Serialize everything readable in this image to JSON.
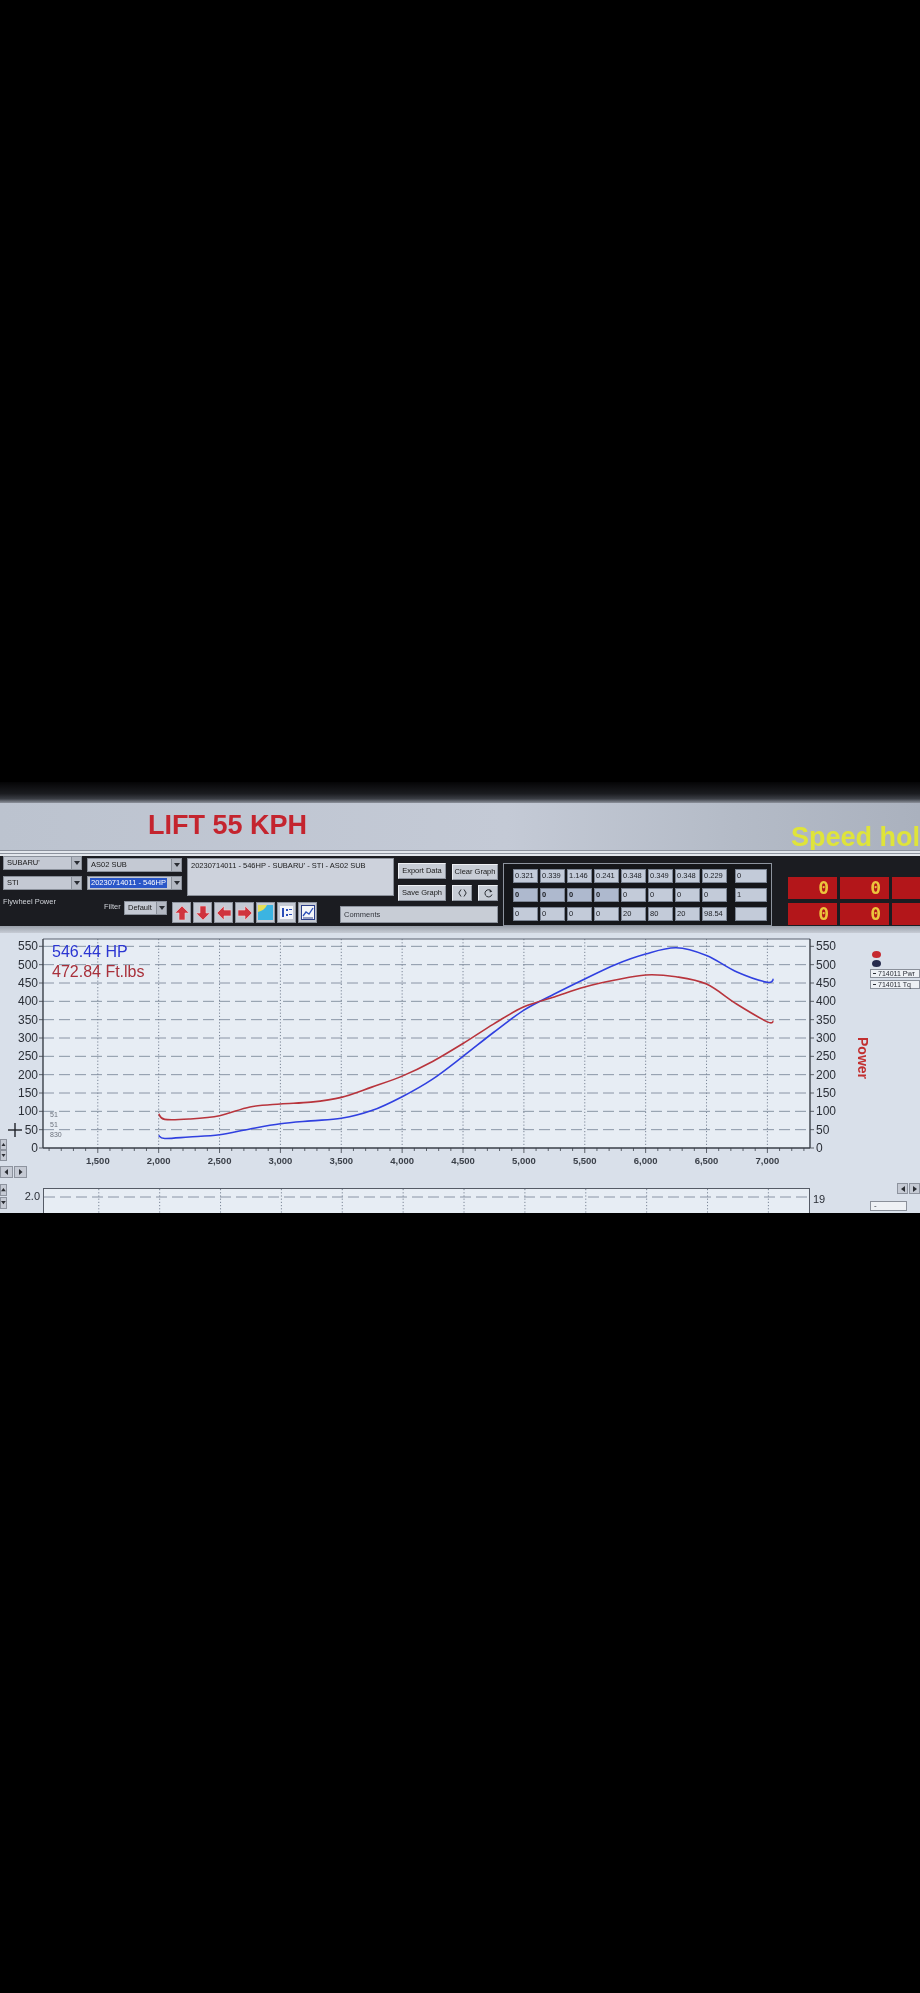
{
  "title_bar": {
    "title": "LIFT 55 KPH",
    "status": "Speed hol"
  },
  "toolbar": {
    "dropdown_columns": [
      [
        {
          "value": "SUBARU'",
          "highlighted": false
        },
        {
          "value": "STI",
          "highlighted": false
        }
      ],
      [
        {
          "value": "AS02 SUB",
          "highlighted": false
        },
        {
          "value": "20230714011 - 546HP",
          "highlighted": true
        }
      ]
    ],
    "power_mode": "Flywheel Power",
    "description": "20230714011 - 546HP - SUBARU' - STI - AS02 SUB",
    "buttons": [
      "Export Data",
      "Save Graph",
      "Clear Graph"
    ],
    "filter": {
      "label": "Filter",
      "value": "Default"
    },
    "comments": {
      "placeholder": "Comments"
    }
  },
  "readings": {
    "rows": [
      [
        {
          "text": "0.321",
          "bold": false
        },
        {
          "text": "0.339",
          "bold": false
        },
        {
          "text": "1.146",
          "bold": false
        },
        {
          "text": "0.241",
          "bold": false
        },
        {
          "text": "0.348",
          "bold": false
        },
        {
          "text": "0.349",
          "bold": false
        },
        {
          "text": "0.348",
          "bold": false
        },
        {
          "text": "0.229",
          "bold": false
        }
      ],
      [
        {
          "text": "0",
          "bold": true
        },
        {
          "text": "0",
          "bold": true
        },
        {
          "text": "0",
          "bold": true
        },
        {
          "text": "0",
          "bold": true
        },
        {
          "text": "0",
          "bold": false
        },
        {
          "text": "0",
          "bold": false
        },
        {
          "text": "0",
          "bold": false
        },
        {
          "text": "0",
          "bold": false
        }
      ],
      [
        {
          "text": "0",
          "bold": false
        },
        {
          "text": "0",
          "bold": false
        },
        {
          "text": "0",
          "bold": false
        },
        {
          "text": "0",
          "bold": false
        },
        {
          "text": "20",
          "bold": false
        },
        {
          "text": "80",
          "bold": false
        },
        {
          "text": "20",
          "bold": false
        },
        {
          "text": "98.54",
          "bold": false
        }
      ]
    ],
    "side_column": [
      "0",
      "1"
    ]
  },
  "led_rows": [
    [
      "0",
      "0"
    ],
    [
      "0",
      "0"
    ]
  ],
  "graph": {
    "readouts": [
      {
        "text": "546.44 HP",
        "color": "#2b36d2"
      },
      {
        "text": "472.84 Ft.lbs",
        "color": "#a8303a"
      }
    ],
    "cursor_readout": [
      "51",
      "51",
      "830"
    ],
    "right_axis": {
      "title": "Power",
      "ticks": [
        "550",
        "500",
        "450",
        "400",
        "350",
        "300",
        "250",
        "200",
        "150",
        "100",
        "50",
        "0"
      ]
    },
    "legend_markers": [
      {
        "color": "#c62a30"
      },
      {
        "color": "#262b4d"
      }
    ],
    "chart_data": {
      "type": "line",
      "grid": true,
      "x": [
        2000,
        2050,
        2250,
        2500,
        2750,
        3000,
        3250,
        3500,
        3750,
        4000,
        4250,
        4500,
        4750,
        5000,
        5250,
        5500,
        5750,
        6000,
        6250,
        6500,
        6750,
        7000,
        7050
      ],
      "series": [
        {
          "name": "714011 Pwr",
          "color": "#3040e0",
          "values": [
            34,
            26,
            30,
            36,
            52,
            66,
            74,
            81,
            102,
            140,
            188,
            250,
            315,
            376,
            420,
            461,
            500,
            529,
            546,
            525,
            480,
            452,
            461
          ]
        },
        {
          "name": "714011 Tq",
          "color": "#b8343c",
          "values": [
            93,
            78,
            79,
            88,
            112,
            120,
            125,
            138,
            166,
            196,
            236,
            285,
            338,
            385,
            412,
            439,
            458,
            472,
            467,
            447,
            392,
            344,
            346
          ]
        }
      ],
      "xlim": [
        1050,
        7350
      ],
      "ylim": [
        0,
        570
      ],
      "xticks": [
        {
          "value": 1500,
          "label": "1,500"
        },
        {
          "value": 2000,
          "label": "2,000"
        },
        {
          "value": 2500,
          "label": "2,500"
        },
        {
          "value": 3000,
          "label": "3,000"
        },
        {
          "value": 3500,
          "label": "3,500"
        },
        {
          "value": 4000,
          "label": "4,000"
        },
        {
          "value": 4500,
          "label": "4,500"
        },
        {
          "value": 5000,
          "label": "5,000"
        },
        {
          "value": 5500,
          "label": "5,500"
        },
        {
          "value": 6000,
          "label": "6,000"
        },
        {
          "value": 6500,
          "label": "6,500"
        },
        {
          "value": 7000,
          "label": "7,000"
        }
      ],
      "yticks": [
        550,
        500,
        450,
        400,
        350,
        300,
        250,
        200,
        150,
        100,
        50,
        0
      ]
    }
  },
  "lower_graph": {
    "left_tick": "2.0",
    "right_tick": "19",
    "field": "-"
  }
}
